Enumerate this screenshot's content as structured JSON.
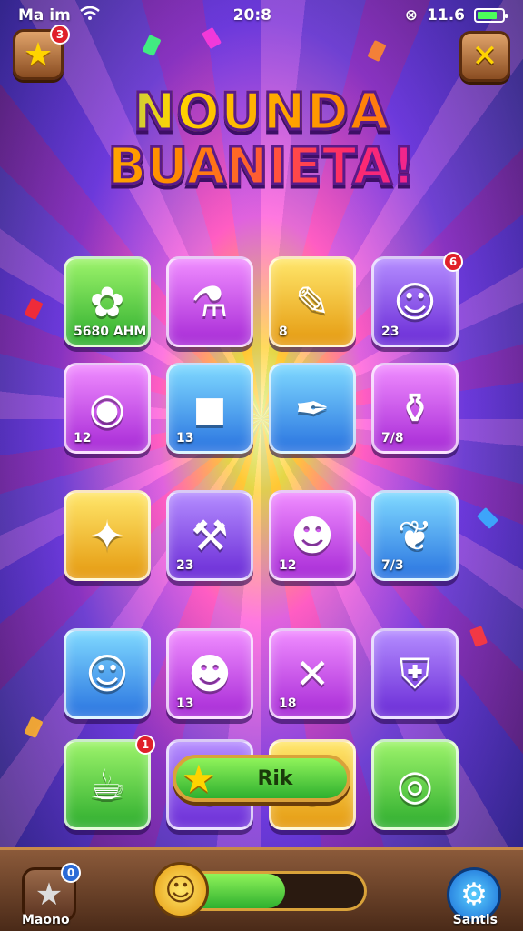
{
  "status": {
    "carrier": "Ma im",
    "time": "20:8",
    "battery_text": "11.6",
    "battery_level": 0.85,
    "wifi_icon": "wifi-icon",
    "alarm_icon": "alarm-icon"
  },
  "header": {
    "star_badge": "3",
    "star_icon": "star-icon",
    "close_icon": "close-icon"
  },
  "title": {
    "line1": "NOUNDA",
    "line2": "BUANIETA!"
  },
  "grid": {
    "rows": [
      [
        {
          "icon": "flower-character-icon",
          "glyph": "✿",
          "count": "5680  AHM",
          "color": "green",
          "badge": ""
        },
        {
          "icon": "cup-icon",
          "glyph": "⚗",
          "count": "",
          "color": "pink",
          "badge": ""
        },
        {
          "icon": "book-pencil-icon",
          "glyph": "✎",
          "count": "8",
          "color": "gold",
          "badge": ""
        },
        {
          "icon": "character-hat-icon",
          "glyph": "☺",
          "count": "23",
          "color": "violet",
          "badge": "6"
        }
      ],
      [
        {
          "icon": "robot-icon",
          "glyph": "◉",
          "count": "12",
          "color": "pink",
          "badge": ""
        },
        {
          "icon": "boot-icon",
          "glyph": "◼",
          "count": "13",
          "color": "blue",
          "badge": ""
        },
        {
          "icon": "syringe-icon",
          "glyph": "✒",
          "count": "",
          "color": "blue",
          "badge": ""
        },
        {
          "icon": "bottle-icon",
          "glyph": "⚱",
          "count": "7/8",
          "color": "pink",
          "badge": ""
        }
      ],
      [
        {
          "icon": "creature-icon",
          "glyph": "✦",
          "count": "",
          "color": "gold",
          "badge": ""
        },
        {
          "icon": "hammer-icon",
          "glyph": "⚒",
          "count": "23",
          "color": "violet",
          "badge": ""
        },
        {
          "icon": "pot-character-icon",
          "glyph": "☻",
          "count": "12",
          "color": "pink",
          "badge": ""
        },
        {
          "icon": "leaf-icon",
          "glyph": "❦",
          "count": "7/3",
          "color": "blue",
          "badge": ""
        }
      ],
      [
        {
          "icon": "elf-icon",
          "glyph": "☺",
          "count": "",
          "color": "blue",
          "badge": ""
        },
        {
          "icon": "potion-character-icon",
          "glyph": "☻",
          "count": "13",
          "color": "pink",
          "badge": ""
        },
        {
          "icon": "crossed-tools-icon",
          "glyph": "✕",
          "count": "18",
          "color": "pink",
          "badge": ""
        },
        {
          "icon": "shield-medal-icon",
          "glyph": "⛨",
          "count": "",
          "color": "violet",
          "badge": ""
        }
      ],
      [
        {
          "icon": "mug-icon",
          "glyph": "☕",
          "count": "",
          "color": "green",
          "badge": "1"
        },
        {
          "icon": "bowl-icon",
          "glyph": "◡",
          "count": "",
          "color": "violet",
          "badge": ""
        },
        {
          "icon": "pot-icon",
          "glyph": "◒",
          "count": "",
          "color": "gold",
          "badge": ""
        },
        {
          "icon": "plate-icon",
          "glyph": "◎",
          "count": "",
          "color": "green",
          "badge": ""
        }
      ]
    ]
  },
  "play": {
    "label": "Rik",
    "star_icon": "star-icon"
  },
  "bottombar": {
    "left_label": "Maono",
    "left_badge": "0",
    "left_icon": "star-icon",
    "right_label": "Santis",
    "right_icon": "gear-icon",
    "progress": 0.62,
    "progress_icon": "smiley-icon"
  }
}
